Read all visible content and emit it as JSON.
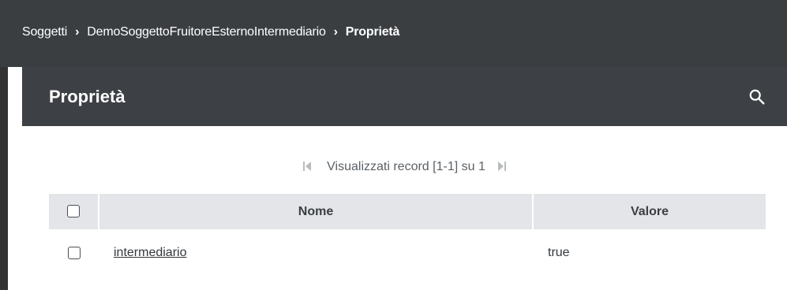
{
  "breadcrumb": {
    "items": [
      "Soggetti",
      "DemoSoggettoFruitoreEsternoIntermediario",
      "Proprietà"
    ],
    "separator": "›"
  },
  "panel": {
    "title": "Proprietà",
    "search_icon": "search-icon"
  },
  "pager": {
    "text": "Visualizzati record [1-1] su 1",
    "first_icon": "first-page-icon",
    "last_icon": "last-page-icon"
  },
  "table": {
    "columns": [
      "Nome",
      "Valore"
    ],
    "rows": [
      {
        "nome": "intermediario",
        "valore": "true"
      }
    ]
  },
  "colors": {
    "breadcrumb_bg": "#3b3e41",
    "header_bg": "#3d4044",
    "table_header_bg": "#e4e5e8"
  }
}
